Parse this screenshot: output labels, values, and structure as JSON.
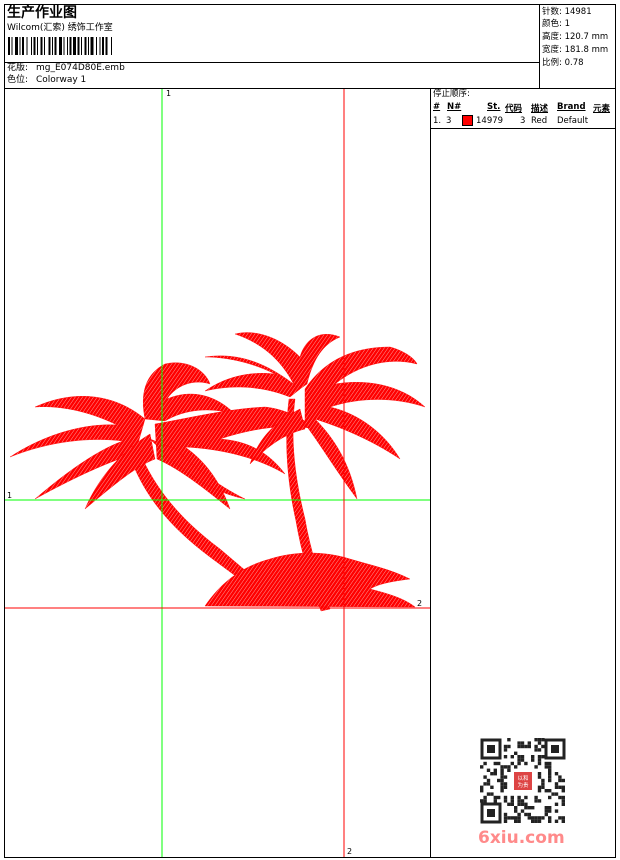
{
  "header": {
    "title": "生产作业图",
    "company": "Wilcom(汇索) 绣饰工作室",
    "design_label": "花版:",
    "design_value": "mg_E074D80E.emb",
    "colorway_label": "色位:",
    "colorway_value": "Colorway 1"
  },
  "stats": [
    {
      "label": "针数:",
      "value": "14981"
    },
    {
      "label": "颜色:",
      "value": "1"
    },
    {
      "label": "高度:",
      "value": "120.7 mm"
    },
    {
      "label": "宽度:",
      "value": "181.8 mm"
    },
    {
      "label": "比例:",
      "value": "0.78"
    }
  ],
  "stop_sequence": {
    "heading": "停止顺序:",
    "columns": [
      "#",
      "N#",
      "St.",
      "代码",
      "描述",
      "Brand",
      "元素"
    ],
    "rows": [
      {
        "index": "1.",
        "needle": "3",
        "color": "#ff0000",
        "stitches": "14979",
        "code": "3",
        "description": "Red",
        "brand": "Default",
        "element": ""
      }
    ]
  },
  "guides": {
    "green_v_label": "1",
    "green_h_label": "1",
    "red_h_label": "2",
    "red_v_label": "2",
    "green_color": "#00ff00",
    "red_color": "#ff0000"
  },
  "design": {
    "color": "#ff0000",
    "description": "palm trees embroidery design"
  },
  "watermark": {
    "text": "6xiu.com",
    "seal_text": "以和为贵"
  }
}
